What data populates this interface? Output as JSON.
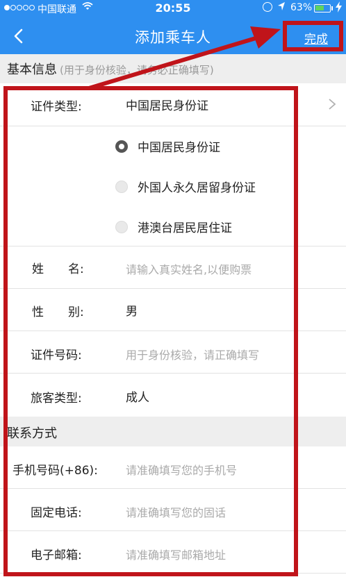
{
  "status_bar": {
    "carrier": "中国联通",
    "time": "20:55",
    "battery": "63%",
    "battery_level": 0.63,
    "wifi_icon": "wifi-icon",
    "lock_icon": "rotation-lock-icon",
    "location_icon": "location-arrow-icon"
  },
  "nav": {
    "title": "添加乘车人",
    "done_label": "完成",
    "back_icon": "chevron-left-icon"
  },
  "basic_section": {
    "title": "基本信息",
    "note": "(用于身份核验，请务必正确填写)"
  },
  "id_type": {
    "label": "证件类型:",
    "value": "中国居民身份证",
    "options": [
      "中国居民身份证",
      "外国人永久居留身份证",
      "港澳台居民居住证"
    ],
    "selected_index": 0
  },
  "name_field": {
    "label_a": "姓",
    "label_b": "名:",
    "placeholder": "请输入真实姓名,以便购票"
  },
  "gender_field": {
    "label_a": "性",
    "label_b": "别:",
    "value": "男"
  },
  "id_number_field": {
    "label": "证件号码:",
    "placeholder": "用于身份核验，请正确填写"
  },
  "passenger_type_field": {
    "label": "旅客类型:",
    "value": "成人"
  },
  "contact_section": {
    "title": "联系方式"
  },
  "mobile_field": {
    "label": "手机号码(+86):",
    "placeholder": "请准确填写您的手机号"
  },
  "landline_field": {
    "label": "固定电话:",
    "placeholder": "请准确填写您的固话"
  },
  "email_field": {
    "label": "电子邮箱:",
    "placeholder": "请准确填写邮箱地址"
  },
  "colors": {
    "nav_bar": "#2e8ff0",
    "section_header": "#eeeeee",
    "annotation": "#c0141a",
    "placeholder_text": "#aaaaaa"
  }
}
